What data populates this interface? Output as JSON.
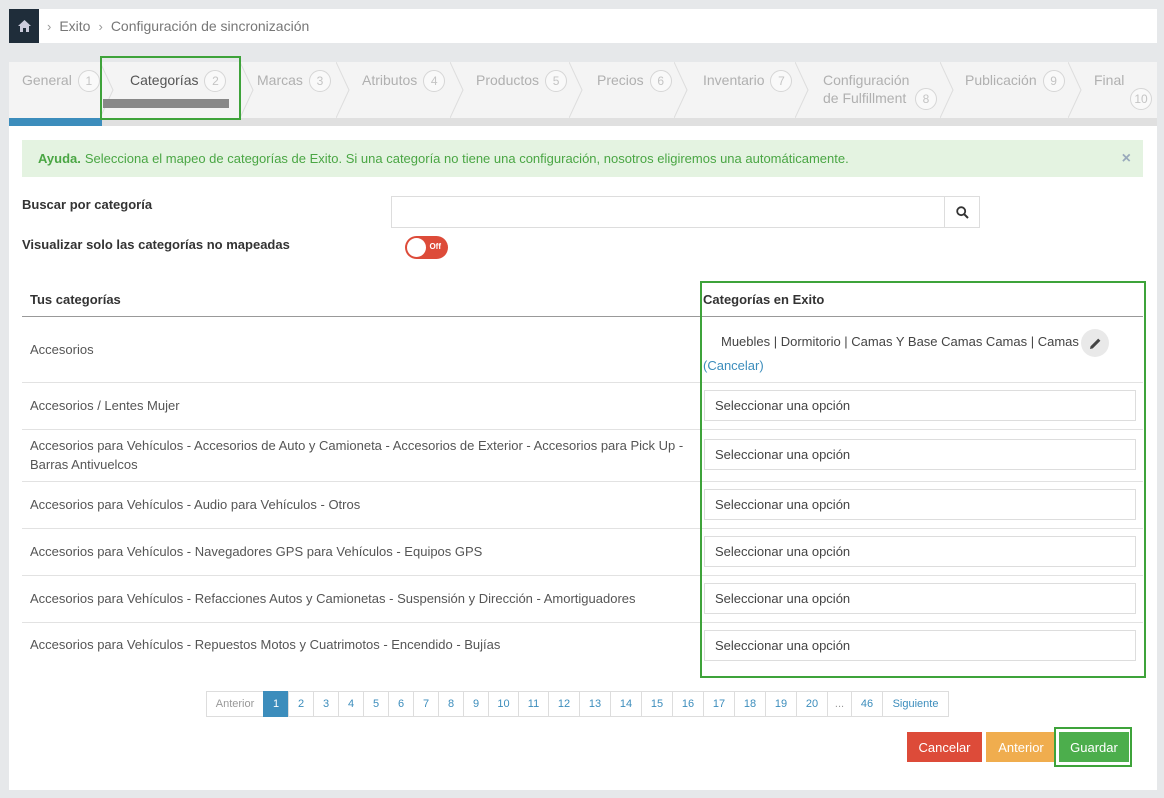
{
  "breadcrumb": {
    "items": [
      "Exito",
      "Configuración de sincronización"
    ]
  },
  "steps": [
    {
      "label": "General",
      "num": "1"
    },
    {
      "label": "Categorías",
      "num": "2"
    },
    {
      "label": "Marcas",
      "num": "3"
    },
    {
      "label": "Atributos",
      "num": "4"
    },
    {
      "label": "Productos",
      "num": "5"
    },
    {
      "label": "Precios",
      "num": "6"
    },
    {
      "label": "Inventario",
      "num": "7"
    },
    {
      "label": "Configuración de Fulfillment",
      "num": "8"
    },
    {
      "label": "Publicación",
      "num": "9"
    },
    {
      "label": "Final",
      "num": "10"
    }
  ],
  "alert": {
    "title": "Ayuda.",
    "text": "Selecciona el mapeo de categorías de Exito. Si una categoría no tiene una configuración, nosotros eligiremos una automáticamente.",
    "close": "×"
  },
  "filters": {
    "search_label": "Buscar por categoría",
    "search_value": "",
    "unmapped_label": "Visualizar solo las categorías no mapeadas",
    "toggle_text": "Off"
  },
  "table": {
    "col_yours": "Tus categorías",
    "col_exito": "Categorías en Exito",
    "rows": [
      {
        "name": "Accesorios",
        "mapping": "Muebles | Dormitorio | Camas Y Base Camas Camas | Camas",
        "cancel": "(Cancelar)"
      },
      {
        "name": "Accesorios / Lentes Mujer",
        "mapping": "Seleccionar una opción"
      },
      {
        "name": "Accesorios para Vehículos - Accesorios de Auto y Camioneta - Accesorios de Exterior - Accesorios para Pick Up - Barras Antivuelcos",
        "mapping": "Seleccionar una opción"
      },
      {
        "name": "Accesorios para Vehículos - Audio para Vehículos - Otros",
        "mapping": "Seleccionar una opción"
      },
      {
        "name": "Accesorios para Vehículos - Navegadores GPS para Vehículos - Equipos GPS",
        "mapping": "Seleccionar una opción"
      },
      {
        "name": "Accesorios para Vehículos - Refacciones Autos y Camionetas - Suspensión y Dirección - Amortiguadores",
        "mapping": "Seleccionar una opción"
      },
      {
        "name": "Accesorios para Vehículos - Repuestos Motos y Cuatrimotos - Encendido - Bujías",
        "mapping": "Seleccionar una opción"
      }
    ]
  },
  "pagination": {
    "prev": "Anterior",
    "pages": [
      "1",
      "2",
      "3",
      "4",
      "5",
      "6",
      "7",
      "8",
      "9",
      "10",
      "11",
      "12",
      "13",
      "14",
      "15",
      "16",
      "17",
      "18",
      "19",
      "20",
      "...",
      "46"
    ],
    "next": "Siguiente",
    "active": "1"
  },
  "actions": {
    "cancel": "Cancelar",
    "previous": "Anterior",
    "save": "Guardar"
  },
  "colors": {
    "accent": "#3c8dbc",
    "danger": "#dd4b39",
    "warning": "#f0ad4e",
    "success": "#4cae4c",
    "highlight": "#3ea33a"
  }
}
